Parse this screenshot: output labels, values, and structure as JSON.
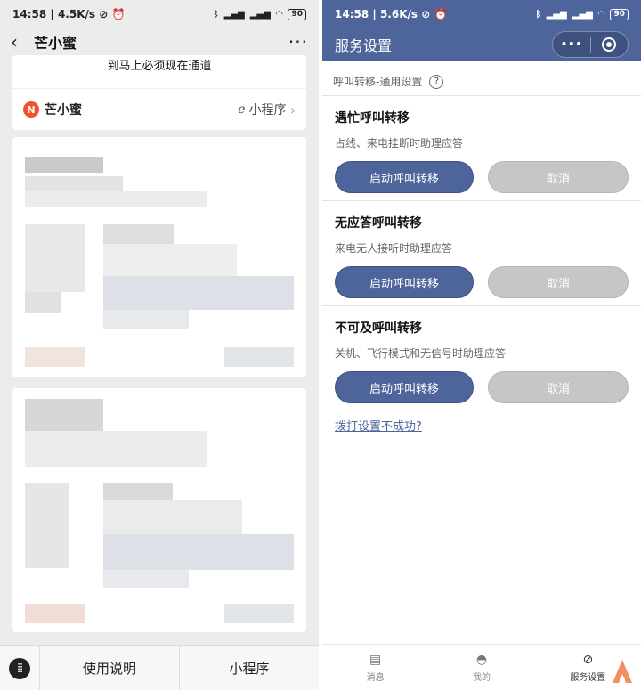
{
  "left": {
    "status": {
      "time": "14:58",
      "speed": "4.5K/s",
      "battery": "90"
    },
    "nav": {
      "title": "芒小蜜",
      "more": "···"
    },
    "notice": "到马上必须现在通道",
    "mp": {
      "logo_letter": "N",
      "name": "芒小蜜",
      "link_label": "小程序"
    },
    "bottom": {
      "btn1": "使用说明",
      "btn2": "小程序"
    }
  },
  "right": {
    "status": {
      "time": "14:58",
      "speed": "5.6K/s",
      "battery": "90"
    },
    "nav": {
      "title": "服务设置",
      "dots": "•••"
    },
    "section_label": "呼叫转移-通用设置",
    "settings": [
      {
        "title": "遇忙呼叫转移",
        "desc": "占线、来电挂断时助理应答",
        "enable": "启动呼叫转移",
        "cancel": "取消"
      },
      {
        "title": "无应答呼叫转移",
        "desc": "来电无人接听时助理应答",
        "enable": "启动呼叫转移",
        "cancel": "取消"
      },
      {
        "title": "不可及呼叫转移",
        "desc": "关机、飞行模式和无信号时助理应答",
        "enable": "启动呼叫转移",
        "cancel": "取消"
      }
    ],
    "help_link": "拨打设置不成功?",
    "tabs": [
      {
        "label": "消息",
        "icon": "message-icon"
      },
      {
        "label": "我的",
        "icon": "user-icon"
      },
      {
        "label": "服务设置",
        "icon": "service-icon",
        "active": true
      }
    ],
    "colors": {
      "primary": "#4e659b",
      "cancel": "#c6c6c6"
    }
  }
}
